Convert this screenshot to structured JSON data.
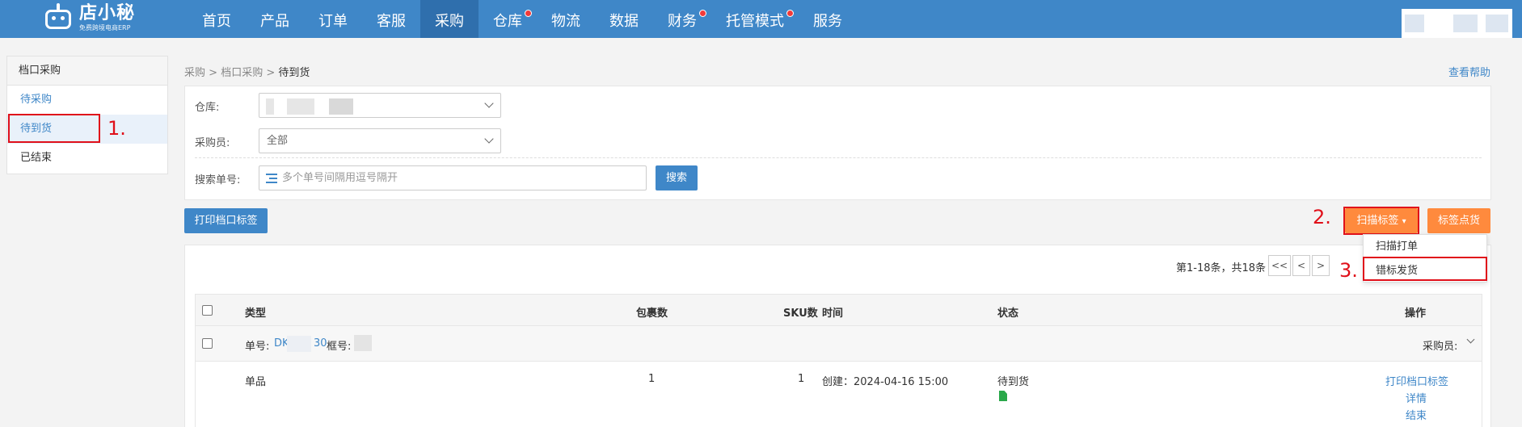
{
  "topnav": {
    "logo_name": "店小秘",
    "logo_sub": "免费跨境电商ERP",
    "items": [
      {
        "label": "首页",
        "dot": false
      },
      {
        "label": "产品",
        "dot": false
      },
      {
        "label": "订单",
        "dot": false
      },
      {
        "label": "客服",
        "dot": false
      },
      {
        "label": "采购",
        "dot": false,
        "active": true
      },
      {
        "label": "仓库",
        "dot": true
      },
      {
        "label": "物流",
        "dot": false
      },
      {
        "label": "数据",
        "dot": false
      },
      {
        "label": "财务",
        "dot": true
      },
      {
        "label": "托管模式",
        "dot": true
      },
      {
        "label": "服务",
        "dot": false
      }
    ],
    "color": "#3f87c8"
  },
  "sidebar": {
    "title": "档口采购",
    "items": [
      {
        "label": "待采购"
      },
      {
        "label": "待到货",
        "active": true
      },
      {
        "label": "已结束"
      }
    ]
  },
  "annotations": {
    "step1": "1.",
    "step2": "2.",
    "step3": "3.",
    "color": "#e0101a"
  },
  "breadcrumb": {
    "a": "采购",
    "sep": " > ",
    "b": "档口采购",
    "c": "待到货"
  },
  "help_link": "查看帮助",
  "filter": {
    "warehouse_label": "仓库:",
    "warehouse_value": "",
    "buyer_label": "采购员:",
    "buyer_value": "全部",
    "search_label": "搜索单号:",
    "search_placeholder": "多个单号间隔用逗号隔开",
    "search_button": "搜索"
  },
  "toolbar": {
    "print_button": "打印档口标签",
    "scan_button": "扫描标签",
    "count_button": "标签点货"
  },
  "scan_menu": {
    "items": [
      "扫描打单",
      "错标发货"
    ]
  },
  "pager": {
    "text": "第1-18条，共18条",
    "first": "<<",
    "prev": "<",
    "next": ">"
  },
  "table": {
    "headers": {
      "type": "类型",
      "packages": "包裹数",
      "sku": "SKU数",
      "time": "时间",
      "status": "状态",
      "actions": "操作"
    },
    "group": {
      "order_label": "单号:",
      "order_value": "DK",
      "order_tail": "30",
      "box_label": "框号:",
      "buyer_label": "采购员:"
    },
    "rows": [
      {
        "type": "单品",
        "packages": "1",
        "sku": "1",
        "time": "创建：2024-04-16 15:00",
        "status": "待到货",
        "actions": [
          "打印档口标签",
          "详情",
          "结束"
        ]
      }
    ]
  }
}
